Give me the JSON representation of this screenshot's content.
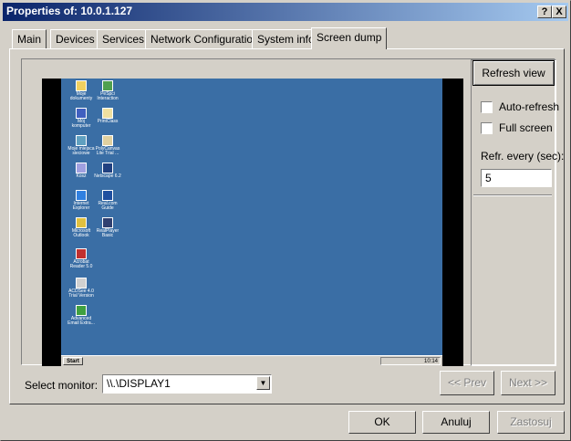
{
  "window": {
    "title": "Properties of: 10.0.1.127",
    "help_btn": "?",
    "close_btn": "X"
  },
  "tabs": [
    {
      "label": "Main"
    },
    {
      "label": "Devices"
    },
    {
      "label": "Services"
    },
    {
      "label": "Network Configuration"
    },
    {
      "label": "System info"
    },
    {
      "label": "Screen dump"
    }
  ],
  "active_tab": "Screen dump",
  "screen_dump": {
    "desktop_icons": [
      {
        "label": "Moje dokumenty",
        "icon": "folder-icon",
        "color": "#f0d060"
      },
      {
        "label": "PeSpci Interaction",
        "icon": "program-icon",
        "color": "#50a050"
      },
      {
        "label": "Mój komputer",
        "icon": "computer-icon",
        "color": "#4060c0"
      },
      {
        "label": "PrintClass",
        "icon": "printer-icon",
        "color": "#f0e0a0"
      },
      {
        "label": "Moje miejsca sieciowe",
        "icon": "network-icon",
        "color": "#60a0c0"
      },
      {
        "label": "PolyCanvas Lite Trial ...",
        "icon": "canvas-icon",
        "color": "#e0d0a0"
      },
      {
        "label": "Kosz",
        "icon": "recycle-bin-icon",
        "color": "#a0a0e0"
      },
      {
        "label": "Netscape 6.2",
        "icon": "netscape-icon",
        "color": "#204080"
      },
      {
        "label": "Internet Explorer",
        "icon": "ie-icon",
        "color": "#3080e0"
      },
      {
        "label": "Real.com Guide",
        "icon": "real-icon",
        "color": "#2050a0"
      },
      {
        "label": "Microsoft Outlook",
        "icon": "outlook-icon",
        "color": "#e0c040"
      },
      {
        "label": "RealPlayer Basic",
        "icon": "realplayer-icon",
        "color": "#304070"
      },
      {
        "label": "Acrobat Reader 5.0",
        "icon": "acrobat-icon",
        "color": "#c03030"
      },
      {
        "label": "ACDSee 4.0 Trial Version",
        "icon": "acdsee-icon",
        "color": "#d0d0d0"
      },
      {
        "label": "Advanced Email Extra...",
        "icon": "email-icon",
        "color": "#40a040"
      }
    ],
    "taskbar": {
      "start": "Start",
      "clock": "10:14"
    },
    "desktop_color": "#3a6ea5"
  },
  "sidebar": {
    "refresh_button": "Refresh view",
    "auto_refresh_label": "Auto-refresh",
    "auto_refresh_checked": false,
    "full_screen_label": "Full screen",
    "full_screen_checked": false,
    "refr_every_label": "Refr. every (sec):",
    "refr_every_value": "5"
  },
  "monitor": {
    "label": "Select monitor:",
    "value": "\\\\.\\DISPLAY1",
    "prev_button": "<< Prev",
    "next_button": "Next >>"
  },
  "footer": {
    "ok_button": "OK",
    "cancel_button": "Anuluj",
    "apply_button": "Zastosuj"
  }
}
